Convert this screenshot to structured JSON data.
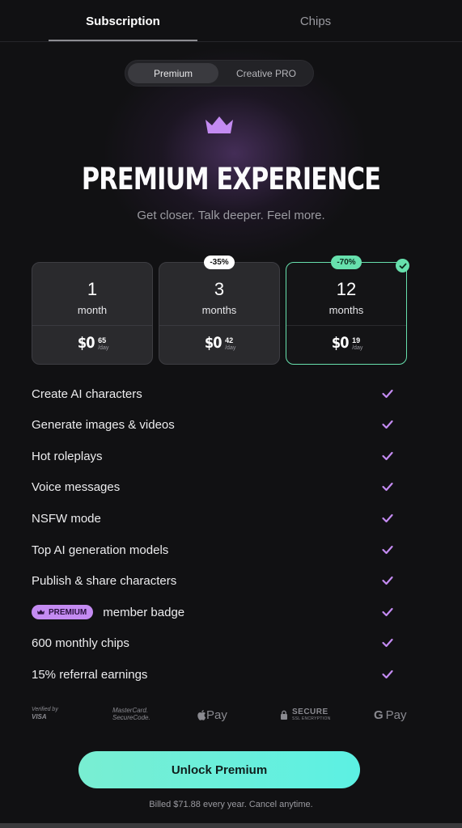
{
  "tabs": [
    {
      "label": "Subscription",
      "active": true
    },
    {
      "label": "Chips",
      "active": false
    }
  ],
  "segment": [
    {
      "label": "Premium",
      "active": true
    },
    {
      "label": "Creative PRO",
      "active": false
    }
  ],
  "hero": {
    "icon": "crown-icon",
    "title": "PREMIUM EXPERIENCE",
    "tagline": "Get closer. Talk deeper. Feel more."
  },
  "plans": [
    {
      "count": "1",
      "unit": "month",
      "dollar": "$0",
      "cents": "65",
      "per": "/day",
      "discount": "",
      "selected": false
    },
    {
      "count": "3",
      "unit": "months",
      "dollar": "$0",
      "cents": "42",
      "per": "/day",
      "discount": "-35%",
      "selected": false
    },
    {
      "count": "12",
      "unit": "months",
      "dollar": "$0",
      "cents": "19",
      "per": "/day",
      "discount": "-70%",
      "selected": true
    }
  ],
  "features": [
    {
      "label": "Create AI characters"
    },
    {
      "label": "Generate images & videos"
    },
    {
      "label": "Hot roleplays"
    },
    {
      "label": "Voice messages"
    },
    {
      "label": "NSFW mode"
    },
    {
      "label": "Top AI generation models"
    },
    {
      "label": "Publish & share characters"
    },
    {
      "label": "member badge",
      "badge": "PREMIUM"
    },
    {
      "label": "600 monthly chips"
    },
    {
      "label": "15% referral earnings"
    }
  ],
  "payments": {
    "visa": {
      "line1": "Verified by",
      "line2": "VISA"
    },
    "mastercard": {
      "line1": "MasterCard.",
      "line2": "SecureCode."
    },
    "apple": {
      "text": "Pay"
    },
    "secure": {
      "line1": "SECURE",
      "line2": "SSL ENCRYPTION"
    },
    "gpay": {
      "text": "Pay"
    }
  },
  "cta": {
    "label": "Unlock Premium"
  },
  "billing_note": "Billed $71.88 every year. Cancel anytime.",
  "colors": {
    "background": "#111113",
    "accent_green": "#67e0ad",
    "accent_purple": "#c48bf2",
    "cta_gradient": [
      "#79eed2",
      "#5cf0e3"
    ]
  }
}
